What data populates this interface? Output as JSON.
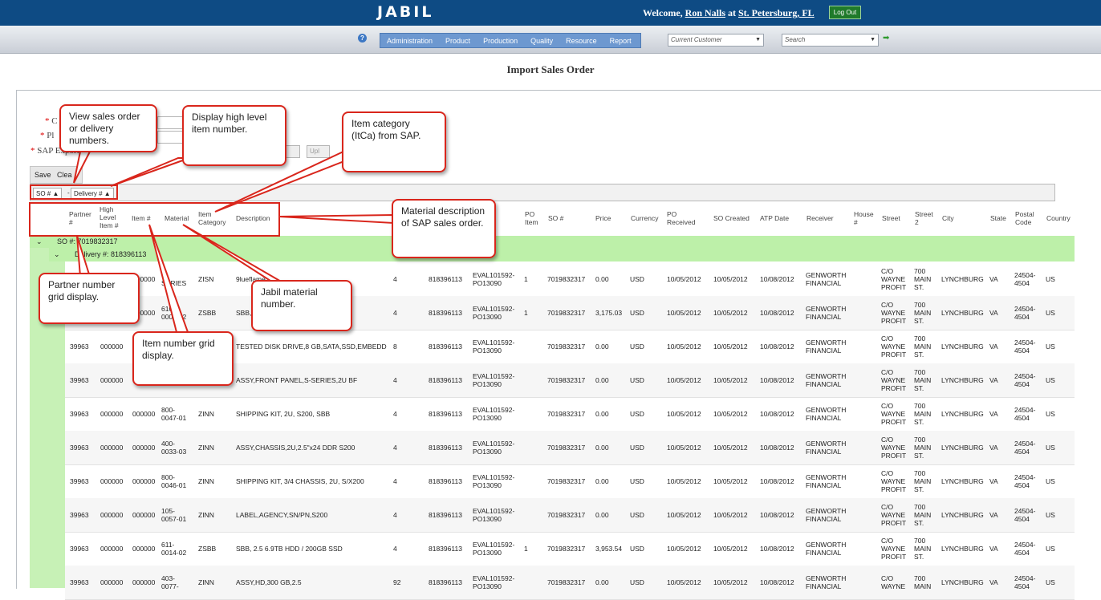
{
  "header": {
    "logo": "JABIL",
    "welcome_prefix": "Welcome,",
    "user": "Ron Nalls",
    "at": "at",
    "site": "St. Petersburg, FL",
    "logout": "Log Out"
  },
  "nav": {
    "menu": [
      "Administration",
      "Product",
      "Production",
      "Quality",
      "Resource",
      "Report"
    ],
    "customer_placeholder": "Current Customer",
    "search_placeholder": "Search"
  },
  "page_title": "Import Sales Order",
  "form": {
    "label_c": "C",
    "label_pl": "Pl",
    "label_sap": "SAP Export",
    "upload_btn": "Upl",
    "save": "Save",
    "clear": "Clea"
  },
  "group_tags": {
    "so": "SO #",
    "delivery": "Delivery #",
    "sep": "-"
  },
  "columns": {
    "partner": "Partner #",
    "high_level": "High Level Item #",
    "item": "Item #",
    "material": "Material",
    "item_category": "Item Category",
    "description": "Description",
    "po_item": "PO Item",
    "so_num": "SO #",
    "price": "Price",
    "currency": "Currency",
    "po_received": "PO Received",
    "so_created": "SO Created",
    "atp_date": "ATP Date",
    "receiver": "Receiver",
    "house": "House #",
    "street": "Street",
    "street2": "Street 2",
    "city": "City",
    "state": "State",
    "postal": "Postal Code",
    "country": "Country"
  },
  "groups": {
    "so_label": "SO #: 7019832317",
    "delivery_label": "Delivery #: 818396113"
  },
  "rows": [
    {
      "partner": "",
      "high": "",
      "item": "000000",
      "material": "S-SERIES",
      "itca": "ZISN",
      "desc": "9lueflame",
      "qty": "4",
      "delivery": "818396113",
      "po": "EVAL101592-PO13090",
      "poitem": "1",
      "so": "7019832317",
      "price": "0.00",
      "cur": "USD",
      "porec": "10/05/2012",
      "socr": "10/05/2012",
      "atp": "10/08/2012",
      "recv": "GENWORTH FINANCIAL",
      "street": "C/O WAYNE PROFIT",
      "street2": "700 MAIN ST.",
      "city": "LYNCHBURG",
      "state": "VA",
      "postal": "24504-4504",
      "country": "US"
    },
    {
      "partner": "",
      "high": "",
      "item": "000000",
      "material": "610-0001-02",
      "itca": "ZSBB",
      "desc": "SBB,",
      "qty": "4",
      "delivery": "818396113",
      "po": "EVAL101592-PO13090",
      "poitem": "1",
      "so": "7019832317",
      "price": "3,175.03",
      "cur": "USD",
      "porec": "10/05/2012",
      "socr": "10/05/2012",
      "atp": "10/08/2012",
      "recv": "GENWORTH FINANCIAL",
      "street": "C/O WAYNE PROFIT",
      "street2": "700 MAIN ST.",
      "city": "LYNCHBURG",
      "state": "VA",
      "postal": "24504-4504",
      "country": "US"
    },
    {
      "partner": "39963",
      "high": "000000",
      "item": "",
      "material": "",
      "itca": "",
      "desc": "TESTED DISK DRIVE,8 GB,SATA,SSD,EMBEDD",
      "qty": "8",
      "delivery": "818396113",
      "po": "EVAL101592-PO13090",
      "poitem": "",
      "so": "7019832317",
      "price": "0.00",
      "cur": "USD",
      "porec": "10/05/2012",
      "socr": "10/05/2012",
      "atp": "10/08/2012",
      "recv": "GENWORTH FINANCIAL",
      "street": "C/O WAYNE PROFIT",
      "street2": "700 MAIN ST.",
      "city": "LYNCHBURG",
      "state": "VA",
      "postal": "24504-4504",
      "country": "US"
    },
    {
      "partner": "39963",
      "high": "000000",
      "item": "",
      "material": "01",
      "itca": "",
      "desc": "ASSY,FRONT PANEL,S-SERIES,2U BF",
      "qty": "4",
      "delivery": "818396113",
      "po": "EVAL101592-PO13090",
      "poitem": "",
      "so": "7019832317",
      "price": "0.00",
      "cur": "USD",
      "porec": "10/05/2012",
      "socr": "10/05/2012",
      "atp": "10/08/2012",
      "recv": "GENWORTH FINANCIAL",
      "street": "C/O WAYNE PROFIT",
      "street2": "700 MAIN ST.",
      "city": "LYNCHBURG",
      "state": "VA",
      "postal": "24504-4504",
      "country": "US"
    },
    {
      "partner": "39963",
      "high": "000000",
      "item": "000000",
      "material": "800-0047-01",
      "itca": "ZINN",
      "desc": "SHIPPING KIT, 2U, S200, SBB",
      "qty": "4",
      "delivery": "818396113",
      "po": "EVAL101592-PO13090",
      "poitem": "",
      "so": "7019832317",
      "price": "0.00",
      "cur": "USD",
      "porec": "10/05/2012",
      "socr": "10/05/2012",
      "atp": "10/08/2012",
      "recv": "GENWORTH FINANCIAL",
      "street": "C/O WAYNE PROFIT",
      "street2": "700 MAIN ST.",
      "city": "LYNCHBURG",
      "state": "VA",
      "postal": "24504-4504",
      "country": "US"
    },
    {
      "partner": "39963",
      "high": "000000",
      "item": "000000",
      "material": "400-0033-03",
      "itca": "ZINN",
      "desc": "ASSY,CHASSIS,2U,2.5\"x24 DDR S200",
      "qty": "4",
      "delivery": "818396113",
      "po": "EVAL101592-PO13090",
      "poitem": "",
      "so": "7019832317",
      "price": "0.00",
      "cur": "USD",
      "porec": "10/05/2012",
      "socr": "10/05/2012",
      "atp": "10/08/2012",
      "recv": "GENWORTH FINANCIAL",
      "street": "C/O WAYNE PROFIT",
      "street2": "700 MAIN ST.",
      "city": "LYNCHBURG",
      "state": "VA",
      "postal": "24504-4504",
      "country": "US"
    },
    {
      "partner": "39963",
      "high": "000000",
      "item": "000000",
      "material": "800-0046-01",
      "itca": "ZINN",
      "desc": "SHIPPING KIT, 3/4 CHASSIS, 2U, S/X200",
      "qty": "4",
      "delivery": "818396113",
      "po": "EVAL101592-PO13090",
      "poitem": "",
      "so": "7019832317",
      "price": "0.00",
      "cur": "USD",
      "porec": "10/05/2012",
      "socr": "10/05/2012",
      "atp": "10/08/2012",
      "recv": "GENWORTH FINANCIAL",
      "street": "C/O WAYNE PROFIT",
      "street2": "700 MAIN ST.",
      "city": "LYNCHBURG",
      "state": "VA",
      "postal": "24504-4504",
      "country": "US"
    },
    {
      "partner": "39963",
      "high": "000000",
      "item": "000000",
      "material": "105-0057-01",
      "itca": "ZINN",
      "desc": "LABEL,AGENCY,SN/PN,S200",
      "qty": "4",
      "delivery": "818396113",
      "po": "EVAL101592-PO13090",
      "poitem": "",
      "so": "7019832317",
      "price": "0.00",
      "cur": "USD",
      "porec": "10/05/2012",
      "socr": "10/05/2012",
      "atp": "10/08/2012",
      "recv": "GENWORTH FINANCIAL",
      "street": "C/O WAYNE PROFIT",
      "street2": "700 MAIN ST.",
      "city": "LYNCHBURG",
      "state": "VA",
      "postal": "24504-4504",
      "country": "US"
    },
    {
      "partner": "39963",
      "high": "000000",
      "item": "000000",
      "material": "611-0014-02",
      "itca": "ZSBB",
      "desc": "SBB, 2.5 6.9TB HDD / 200GB SSD",
      "qty": "4",
      "delivery": "818396113",
      "po": "EVAL101592-PO13090",
      "poitem": "1",
      "so": "7019832317",
      "price": "3,953.54",
      "cur": "USD",
      "porec": "10/05/2012",
      "socr": "10/05/2012",
      "atp": "10/08/2012",
      "recv": "GENWORTH FINANCIAL",
      "street": "C/O WAYNE PROFIT",
      "street2": "700 MAIN ST.",
      "city": "LYNCHBURG",
      "state": "VA",
      "postal": "24504-4504",
      "country": "US"
    },
    {
      "partner": "39963",
      "high": "000000",
      "item": "000000",
      "material": "403-0077-",
      "itca": "ZINN",
      "desc": "ASSY,HD,300 GB,2.5",
      "qty": "92",
      "delivery": "818396113",
      "po": "EVAL101592-PO13090",
      "poitem": "",
      "so": "7019832317",
      "price": "0.00",
      "cur": "USD",
      "porec": "10/05/2012",
      "socr": "10/05/2012",
      "atp": "10/08/2012",
      "recv": "GENWORTH FINANCIAL",
      "street": "C/O WAYNE",
      "street2": "700 MAIN",
      "city": "LYNCHBURG",
      "state": "VA",
      "postal": "24504-4504",
      "country": "US"
    }
  ],
  "callouts": {
    "view_numbers": "View sales order or delivery numbers.",
    "high_level": "Display high level item number.",
    "item_category": "Item category (ItCa) from SAP.",
    "material_desc": "Material description of SAP sales order.",
    "partner_grid": "Partner number grid display.",
    "jabil_material": "Jabil material number.",
    "item_grid": "Item number grid display."
  },
  "colors": {
    "topbar": "#0e4b84",
    "group_green": "#bdf0a9",
    "callout_border": "#d9261c"
  }
}
